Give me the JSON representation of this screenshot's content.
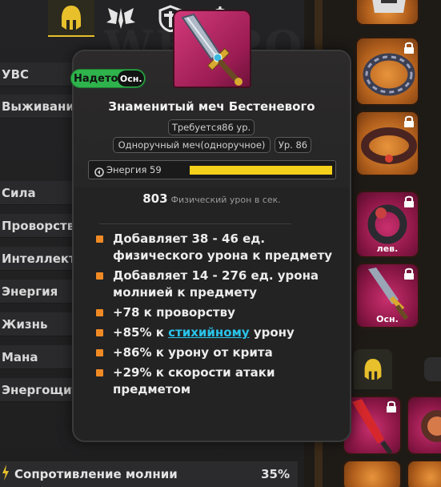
{
  "background": {
    "watermark": "WEAPON",
    "stats": [
      "УВС",
      "Выживание",
      "Сила",
      "Проворство",
      "Интеллект",
      "Энергия",
      "Жизнь",
      "Мана",
      "Энергощит"
    ],
    "resistance": {
      "label": "Сопротивление молнии",
      "value": "35%"
    }
  },
  "inventory": {
    "slot_labels": {
      "ring": "лев.",
      "weapon": "Осн."
    }
  },
  "tooltip": {
    "equipped_label": "Надето",
    "slot_badge": "Осн.",
    "item_name": "Знаменитый меч Бестеневого",
    "requirement": "Требуется86 ур.",
    "item_type": "Одноручный меч(одноручное)",
    "item_level": "Ур. 86",
    "energy_label": "Энергия 59",
    "energy_fill_fraction": 1.0,
    "dps_value": "803",
    "dps_label": "Физический урон в сек.",
    "mods": [
      {
        "text": "Добавляет 38 - 46 ед. физического урона к предмету"
      },
      {
        "text": "Добавляет 14 - 276 ед. урона молнией к предмету"
      },
      {
        "text": "+78 к проворству"
      },
      {
        "prefix": "+85% к ",
        "link": "стихийному",
        "suffix": " урону"
      },
      {
        "text": "+86% к урону от крита"
      },
      {
        "text": "+29% к скорости атаки предметом"
      }
    ]
  },
  "colors": {
    "accent_gold": "#e7c02c",
    "equipped_green": "#2fb34c",
    "energy_yellow": "#f4d01a",
    "bullet_orange": "#f08a24",
    "keyword_cyan": "#29c3ea",
    "rarity_pink": "#c9306e",
    "rarity_orange": "#e8943c"
  },
  "icons": [
    "helmet-tab-icon",
    "wings-tab-icon",
    "shield-tab-icon",
    "target-tab-icon",
    "lock-icon",
    "energy-icon",
    "sword-icon",
    "ring-icon",
    "bracelet-icon",
    "belt-icon"
  ]
}
